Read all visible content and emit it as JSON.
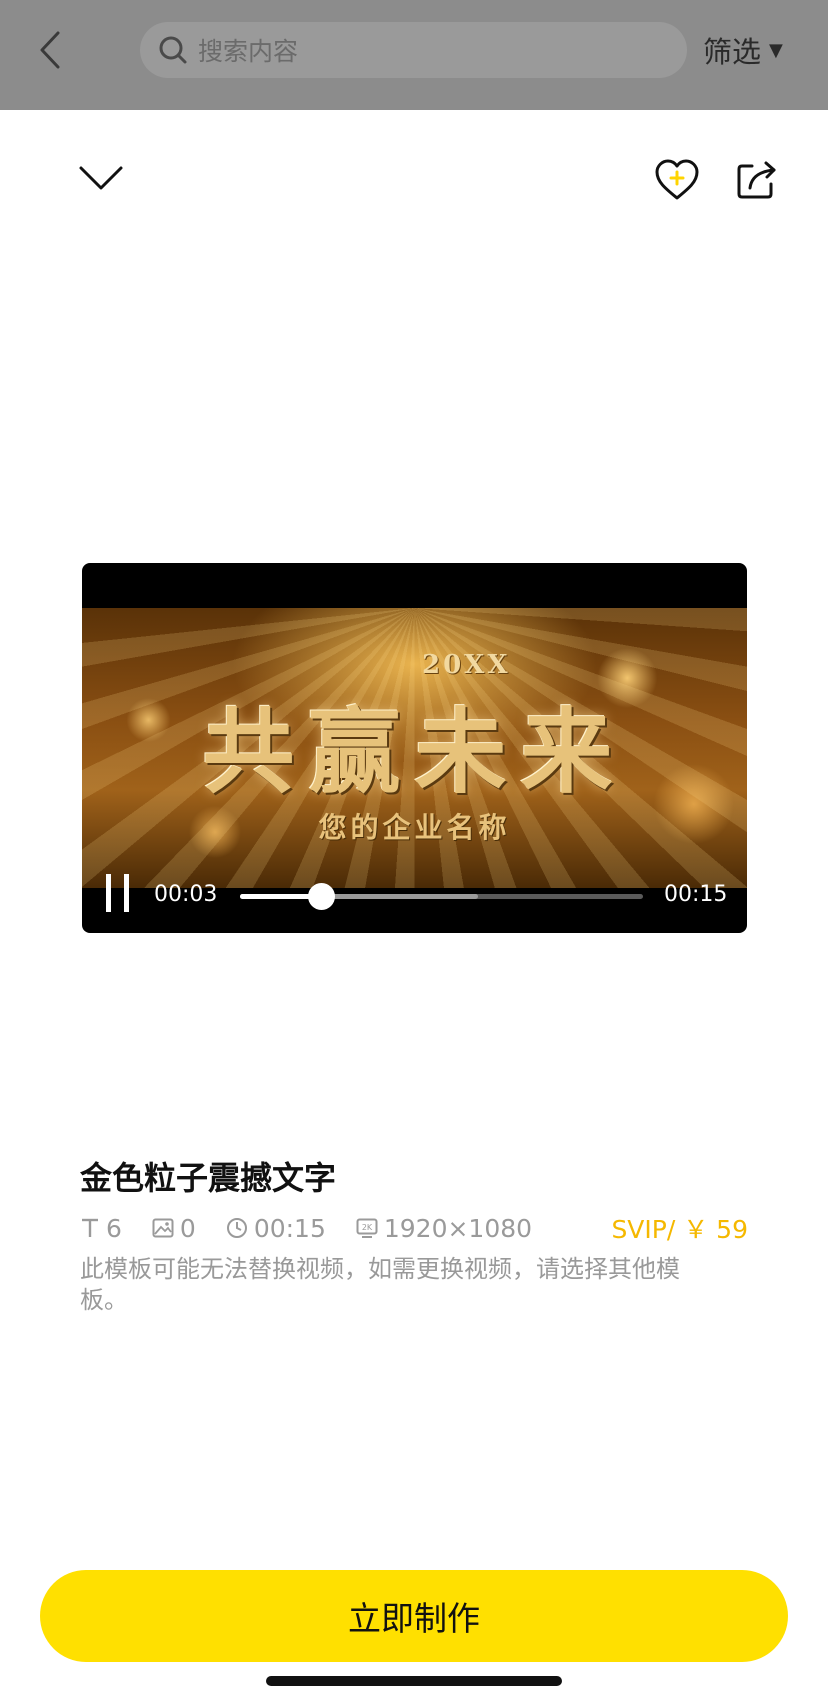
{
  "search": {
    "placeholder": "搜索内容"
  },
  "filter": {
    "label": "筛选"
  },
  "video": {
    "overlay_year": "20XX",
    "overlay_title": "共赢未来",
    "overlay_subtitle": "您的企业名称",
    "current_time": "00:03",
    "duration": "00:15",
    "progress_fraction": 0.2,
    "buffered_fraction": 0.59
  },
  "template": {
    "title": "金色粒子震撼文字",
    "text_count": "6",
    "image_count": "0",
    "duration": "00:15",
    "resolution": "1920×1080",
    "price": "SVIP/ ￥ 59",
    "notice": " 此模板可能无法替换视频，如需更换视频，请选择其他模板。"
  },
  "cta": {
    "label": "立即制作"
  },
  "colors": {
    "accent": "#ffe000",
    "price": "#f5b800"
  },
  "icons": [
    "back-arrow-icon",
    "search-icon",
    "dropdown-triangle-icon",
    "collapse-chevron-icon",
    "favorite-heart-plus-icon",
    "share-icon",
    "pause-icon",
    "text-icon",
    "image-icon",
    "clock-icon",
    "resolution-icon"
  ]
}
